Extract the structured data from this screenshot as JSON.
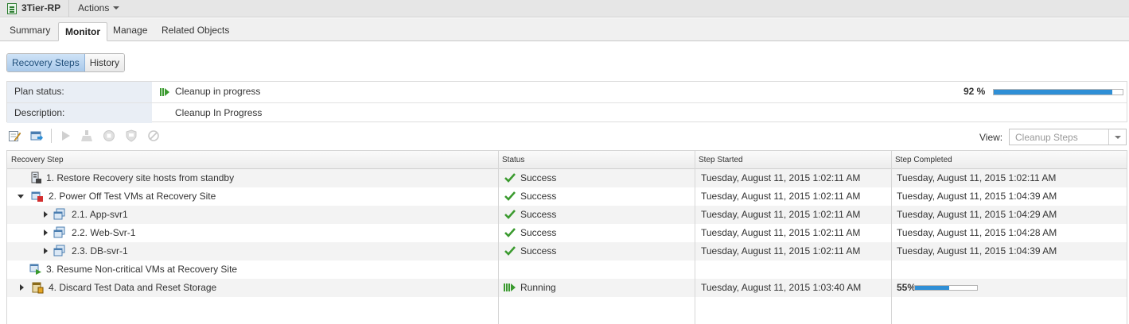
{
  "header": {
    "title": "3Tier-RP",
    "actions_label": "Actions"
  },
  "tabs": [
    {
      "label": "Summary"
    },
    {
      "label": "Monitor"
    },
    {
      "label": "Manage"
    },
    {
      "label": "Related Objects"
    }
  ],
  "active_tab": "Monitor",
  "subview": {
    "recovery_steps": "Recovery Steps",
    "history": "History",
    "active": "Recovery Steps"
  },
  "plan": {
    "status_label": "Plan status:",
    "status_value": "Cleanup in progress",
    "description_label": "Description:",
    "description_value": "Cleanup In Progress",
    "progress_text": "92 %",
    "progress": 0.92
  },
  "toolbar": {
    "view_label": "View:",
    "view_value": "Cleanup Steps",
    "icons": [
      "edit-icon",
      "export-icon",
      "run-icon",
      "cleanup-icon",
      "stop-icon",
      "shield-icon",
      "cancel-icon"
    ]
  },
  "table": {
    "columns": [
      "Recovery Step",
      "Status",
      "Step Started",
      "Step Completed"
    ],
    "rows": [
      {
        "step": "1. Restore Recovery site hosts from standby",
        "status": "Success",
        "started": "Tuesday, August 11, 2015 1:02:11 AM",
        "completed": "Tuesday, August 11, 2015 1:02:11 AM"
      },
      {
        "step": "2. Power Off Test VMs at Recovery Site",
        "status": "Success",
        "started": "Tuesday, August 11, 2015 1:02:11 AM",
        "completed": "Tuesday, August 11, 2015 1:04:39 AM"
      },
      {
        "step": "2.1. App-svr1",
        "status": "Success",
        "started": "Tuesday, August 11, 2015 1:02:11 AM",
        "completed": "Tuesday, August 11, 2015 1:04:29 AM"
      },
      {
        "step": "2.2. Web-Svr-1",
        "status": "Success",
        "started": "Tuesday, August 11, 2015 1:02:11 AM",
        "completed": "Tuesday, August 11, 2015 1:04:28 AM"
      },
      {
        "step": "2.3. DB-svr-1",
        "status": "Success",
        "started": "Tuesday, August 11, 2015 1:02:11 AM",
        "completed": "Tuesday, August 11, 2015 1:04:39 AM"
      },
      {
        "step": "3. Resume Non-critical VMs at Recovery Site",
        "status": "",
        "started": "",
        "completed": ""
      },
      {
        "step": "4. Discard Test Data and Reset Storage",
        "status": "Running",
        "started": "Tuesday, August 11, 2015 1:03:40 AM",
        "completed_progress_text": "55%",
        "completed_progress": 0.55
      }
    ]
  },
  "colors": {
    "accent": "#2f8fd6",
    "success": "#3a9a2e",
    "running": "#3a9a2e"
  }
}
